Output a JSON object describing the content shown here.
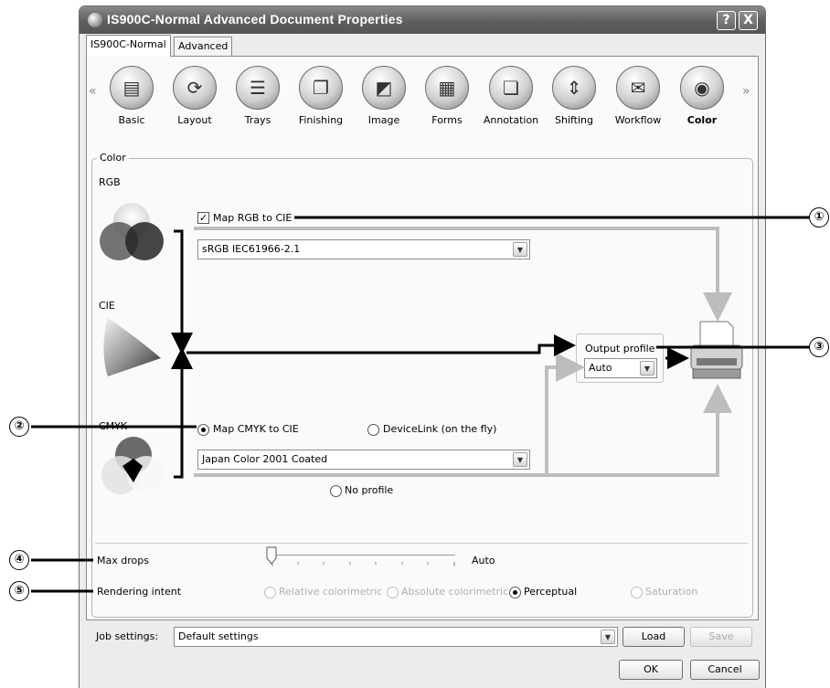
{
  "window": {
    "title": "IS900C-Normal Advanced Document Properties",
    "help_button": "?",
    "close_button": "X"
  },
  "tabs": [
    {
      "label": "IS900C-Normal",
      "active": true
    },
    {
      "label": "Advanced",
      "active": false
    }
  ],
  "categories": [
    {
      "label": "Basic",
      "icon": "document-icon"
    },
    {
      "label": "Layout",
      "icon": "layout-icon"
    },
    {
      "label": "Trays",
      "icon": "trays-icon"
    },
    {
      "label": "Finishing",
      "icon": "finishing-icon"
    },
    {
      "label": "Image",
      "icon": "image-icon"
    },
    {
      "label": "Forms",
      "icon": "forms-icon"
    },
    {
      "label": "Annotation",
      "icon": "annotation-icon"
    },
    {
      "label": "Shifting",
      "icon": "shifting-icon"
    },
    {
      "label": "Workflow",
      "icon": "workflow-icon"
    },
    {
      "label": "Color",
      "icon": "color-icon",
      "selected": true
    }
  ],
  "scroll": {
    "left": "«",
    "right": "»"
  },
  "color_group": {
    "legend": "Color",
    "rgb_label": "RGB",
    "map_rgb_checkbox": {
      "label": "Map RGB to CIE",
      "checked": true
    },
    "rgb_profile": "sRGB IEC61966-2.1",
    "cie_label": "CIE",
    "output_profile_label": "Output profile",
    "output_profile_value": "Auto",
    "cmyk_label": "CMYK",
    "map_cmyk_radio": {
      "label": "Map CMYK to CIE",
      "selected": true
    },
    "devicelink_radio": {
      "label": "DeviceLink (on the fly)",
      "selected": false
    },
    "cmyk_profile": "Japan Color 2001 Coated",
    "no_profile_radio": {
      "label": "No profile",
      "selected": false
    }
  },
  "max_drops": {
    "label": "Max drops",
    "value_text": "Auto",
    "level": 0
  },
  "rendering_intent": {
    "label": "Rendering intent",
    "options": [
      {
        "label": "Relative colorimetric",
        "selected": false,
        "enabled": false
      },
      {
        "label": "Absolute colorimetric",
        "selected": false,
        "enabled": false
      },
      {
        "label": "Perceptual",
        "selected": true,
        "enabled": true
      },
      {
        "label": "Saturation",
        "selected": false,
        "enabled": false
      }
    ]
  },
  "job_settings": {
    "label": "Job settings:",
    "value": "Default settings",
    "load_button": "Load",
    "save_button": "Save"
  },
  "dialog_buttons": {
    "ok": "OK",
    "cancel": "Cancel"
  },
  "callouts": [
    "①",
    "②",
    "③",
    "④",
    "⑤"
  ]
}
